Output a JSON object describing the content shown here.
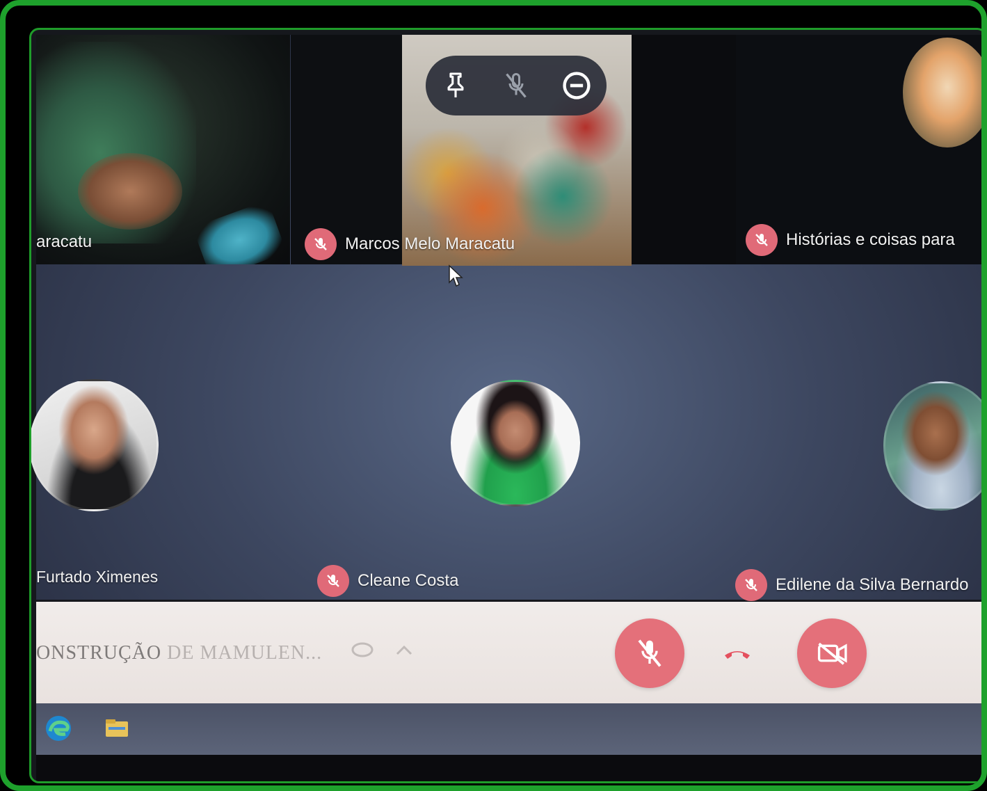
{
  "tiles": {
    "left_partial_name": "aracatu",
    "center_name": "Marcos Melo Maracatu",
    "right_name": "Histórias e coisas para"
  },
  "participants": {
    "left_name": "Furtado Ximenes",
    "center_name": "Cleane Costa",
    "right_name": "Edilene da Silva Bernardo"
  },
  "meeting": {
    "title_visible": "ONSTRUÇÃO",
    "title_blurred": "DE MAMULEN..."
  },
  "colors": {
    "frame": "#1ea12c",
    "mute_badge": "#e06a78",
    "control_button": "#e4707a",
    "control_bar": "#f1ecea"
  },
  "icons": {
    "tile_controls": [
      "pin-icon",
      "mic-off-icon",
      "remove-icon"
    ],
    "bar_controls": [
      "mic-off-icon",
      "hang-up-icon",
      "camera-off-icon"
    ],
    "taskbar": [
      "edge-icon",
      "file-explorer-icon"
    ]
  }
}
